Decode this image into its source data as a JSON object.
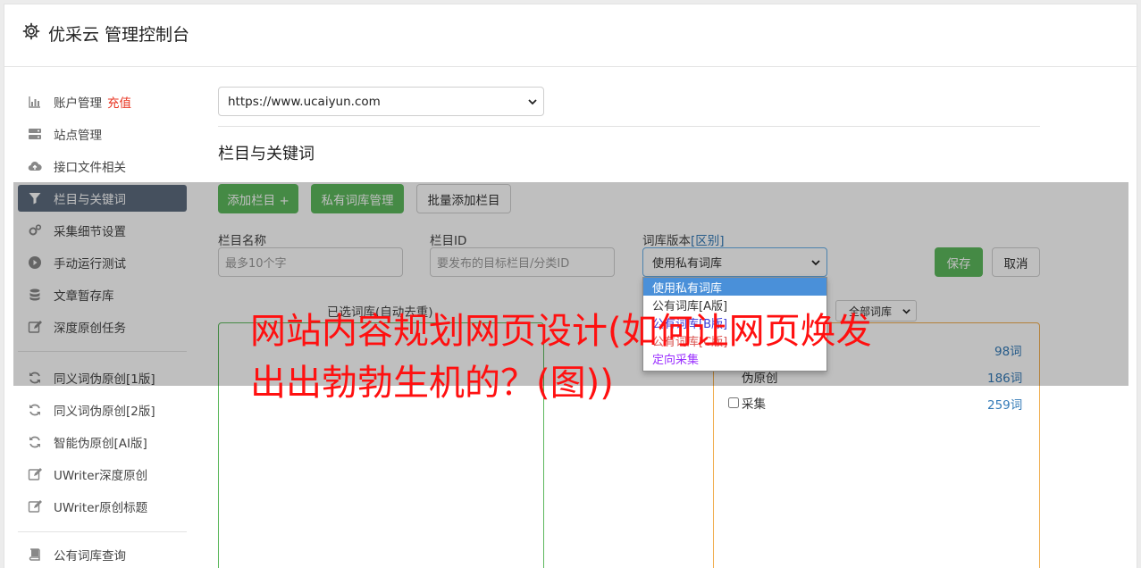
{
  "header": {
    "title": "优采云 管理控制台",
    "icon": "gear-icon"
  },
  "sidebar": {
    "items": [
      {
        "label": "账户管理",
        "tag": "充值",
        "icon": "bar-chart-icon"
      },
      {
        "label": "站点管理",
        "icon": "server-icon"
      },
      {
        "label": "接口文件相关",
        "icon": "cloud-upload-icon"
      },
      {
        "label": "栏目与关键词",
        "icon": "filter-icon",
        "active": true
      },
      {
        "label": "采集细节设置",
        "icon": "gears-icon"
      },
      {
        "label": "手动运行测试",
        "icon": "play-circle-icon"
      },
      {
        "label": "文章暂存库",
        "icon": "database-icon"
      },
      {
        "label": "深度原创任务",
        "icon": "edit-icon"
      },
      {
        "label": "同义词伪原创[1版]",
        "icon": "refresh-icon"
      },
      {
        "label": "同义词伪原创[2版]",
        "icon": "refresh-icon"
      },
      {
        "label": "智能伪原创[AI版]",
        "icon": "refresh-icon"
      },
      {
        "label": "UWriter深度原创",
        "icon": "edit-icon"
      },
      {
        "label": "UWriter原创标题",
        "icon": "edit-icon"
      },
      {
        "label": "公有词库查询",
        "icon": "book-icon"
      }
    ]
  },
  "main": {
    "site_select_value": "https://www.ucaiyun.com",
    "section_title": "栏目与关键词",
    "buttons": {
      "add_column": "添加栏目 +",
      "private_library": "私有词库管理",
      "batch_add": "批量添加栏目",
      "save": "保存",
      "cancel": "取消"
    },
    "form": {
      "column_name_label": "栏目名称",
      "column_name_placeholder": "最多10个字",
      "column_id_label": "栏目ID",
      "column_id_placeholder": "要发布的目标栏目/分类ID",
      "library_version_label": "词库版本",
      "library_version_link": "[区别]",
      "library_version_value": "使用私有词库",
      "library_options": [
        {
          "label": "使用私有词库",
          "color": "#ffffff"
        },
        {
          "label": "公有词库[A版]",
          "color": "#333333"
        },
        {
          "label": "公有词库[B版]",
          "color": "#3b3bd9"
        },
        {
          "label": "公有词库[C版]",
          "color": "#d9534f"
        },
        {
          "label": "定向采集",
          "color": "#9b30ff"
        }
      ]
    },
    "selected_caption": "已选词库(自动去重)",
    "all_library_select": "全部词库",
    "library_counts": [
      "98词",
      "186词",
      "259词"
    ],
    "checkbox_items": [
      "采集"
    ],
    "partial_label": "伪原创"
  },
  "headline": "网站内容规划网页设计(如何让网页焕发出出勃勃生机的？(图))",
  "colors": {
    "green": "#5cb85c",
    "orange": "#f0ad4e",
    "active_sidebar": "#5c6b7e",
    "headline": "#ff1010"
  }
}
